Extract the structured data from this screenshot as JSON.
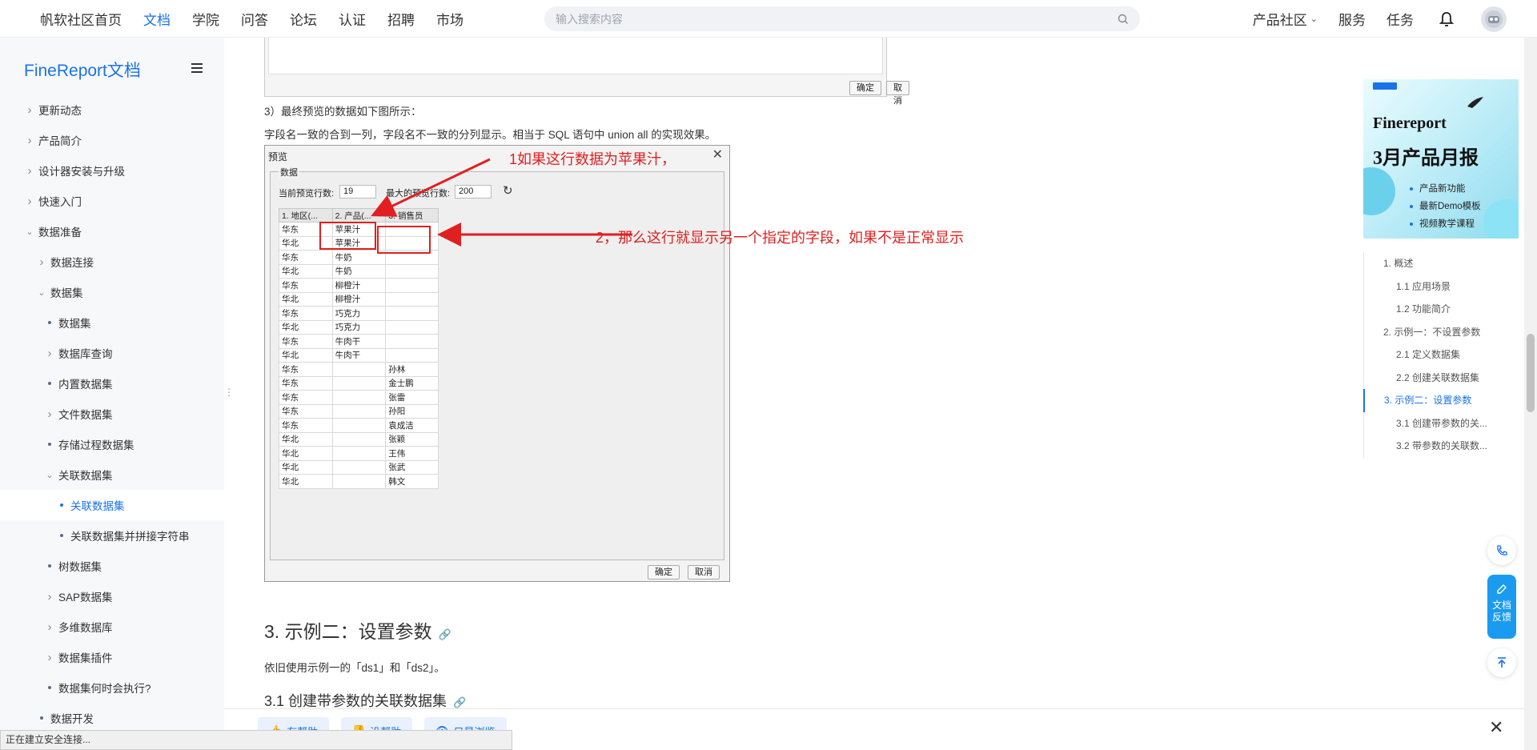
{
  "topnav": {
    "items": [
      "帆软社区首页",
      "文档",
      "学院",
      "问答",
      "论坛",
      "认证",
      "招聘",
      "市场"
    ],
    "active_index": 1,
    "search_placeholder": "输入搜索内容",
    "right": [
      "产品社区",
      "服务",
      "任务"
    ]
  },
  "sidebar": {
    "title": "FineReport文档",
    "items": [
      {
        "label": "更新动态",
        "kind": "chev-right",
        "indent": 0
      },
      {
        "label": "产品简介",
        "kind": "chev-right",
        "indent": 0
      },
      {
        "label": "设计器安装与升级",
        "kind": "chev-right",
        "indent": 0
      },
      {
        "label": "快速入门",
        "kind": "chev-right",
        "indent": 0
      },
      {
        "label": "数据准备",
        "kind": "chev-down",
        "indent": 0
      },
      {
        "label": "数据连接",
        "kind": "chev-right",
        "indent": 1
      },
      {
        "label": "数据集",
        "kind": "chev-down",
        "indent": 1
      },
      {
        "label": "数据集",
        "kind": "dot",
        "indent": 2
      },
      {
        "label": "数据库查询",
        "kind": "chev-right",
        "indent": 2
      },
      {
        "label": "内置数据集",
        "kind": "dot",
        "indent": 2
      },
      {
        "label": "文件数据集",
        "kind": "chev-right",
        "indent": 2
      },
      {
        "label": "存储过程数据集",
        "kind": "dot",
        "indent": 2
      },
      {
        "label": "关联数据集",
        "kind": "chev-down",
        "indent": 2
      },
      {
        "label": "关联数据集",
        "kind": "dot",
        "indent": 3,
        "selected": true
      },
      {
        "label": "关联数据集并拼接字符串",
        "kind": "dot",
        "indent": 3
      },
      {
        "label": "树数据集",
        "kind": "dot",
        "indent": 2
      },
      {
        "label": "SAP数据集",
        "kind": "chev-right",
        "indent": 2
      },
      {
        "label": "多维数据库",
        "kind": "chev-right",
        "indent": 2
      },
      {
        "label": "数据集插件",
        "kind": "chev-right",
        "indent": 2
      },
      {
        "label": "数据集何时会执行?",
        "kind": "dot",
        "indent": 2
      },
      {
        "label": "数据开发",
        "kind": "dot",
        "indent": 1
      }
    ]
  },
  "content": {
    "top_dialog": {
      "ok": "确定",
      "cancel": "取消"
    },
    "step3": "3）最终预览的数据如下图所示：",
    "step3_desc": "字段名一致的合到一列，字段名不一致的分列显示。相当于 SQL 语句中 union all 的实现效果。",
    "preview": {
      "title": "预览",
      "group": "数据",
      "rows_label": "当前预览行数:",
      "rows_value": "19",
      "max_label": "最大的预览行数:",
      "max_value": "200",
      "headers": [
        "1. 地区(...",
        "2. 产品(...",
        "3. 销售员"
      ],
      "rows": [
        [
          "华东",
          "苹果汁",
          ""
        ],
        [
          "华北",
          "苹果汁",
          ""
        ],
        [
          "华东",
          "牛奶",
          ""
        ],
        [
          "华北",
          "牛奶",
          ""
        ],
        [
          "华东",
          "柳橙汁",
          ""
        ],
        [
          "华北",
          "柳橙汁",
          ""
        ],
        [
          "华东",
          "巧克力",
          ""
        ],
        [
          "华北",
          "巧克力",
          ""
        ],
        [
          "华东",
          "牛肉干",
          ""
        ],
        [
          "华北",
          "牛肉干",
          ""
        ],
        [
          "华东",
          "",
          "孙林"
        ],
        [
          "华东",
          "",
          "金士鹏"
        ],
        [
          "华东",
          "",
          "张雷"
        ],
        [
          "华东",
          "",
          "孙阳"
        ],
        [
          "华东",
          "",
          "袁成洁"
        ],
        [
          "华北",
          "",
          "张颖"
        ],
        [
          "华北",
          "",
          "王伟"
        ],
        [
          "华北",
          "",
          "张武"
        ],
        [
          "华北",
          "",
          "韩文"
        ]
      ],
      "ok": "确定",
      "cancel": "取消"
    },
    "annotation1": "1如果这行数据为苹果汁，",
    "annotation2": "2，那么这行就显示另一个指定的字段，如果不是正常显示",
    "section3_title": "3. 示例二：设置参数",
    "section3_desc": "依旧使用示例一的「ds1」和「ds2」。",
    "section31_title": "3.1 创建带参数的关联数据集"
  },
  "banner": {
    "line1": "Finereport",
    "line2": "3月产品月报",
    "bullets": [
      "产品新功能",
      "最新Demo模板",
      "视频教学课程"
    ]
  },
  "toc": [
    {
      "label": "1. 概述",
      "level": 1
    },
    {
      "label": "1.1 应用场景",
      "level": 2
    },
    {
      "label": "1.2 功能简介",
      "level": 2
    },
    {
      "label": "2. 示例一：不设置参数",
      "level": 1
    },
    {
      "label": "2.1 定义数据集",
      "level": 2
    },
    {
      "label": "2.2 创建关联数据集",
      "level": 2
    },
    {
      "label": "3. 示例二：设置参数",
      "level": 1,
      "current": true
    },
    {
      "label": "3.1 创建带参数的关...",
      "level": 2
    },
    {
      "label": "3.2 带参数的关联数...",
      "level": 2
    }
  ],
  "float": {
    "feedback_line1": "文档",
    "feedback_line2": "反馈"
  },
  "bottom": {
    "helpful": "有帮助",
    "not_helpful": "没帮助",
    "browse_only": "只是浏览"
  },
  "status": "正在建立安全连接...",
  "colors": {
    "accent": "#1a73e8",
    "annotation": "#e02020"
  }
}
